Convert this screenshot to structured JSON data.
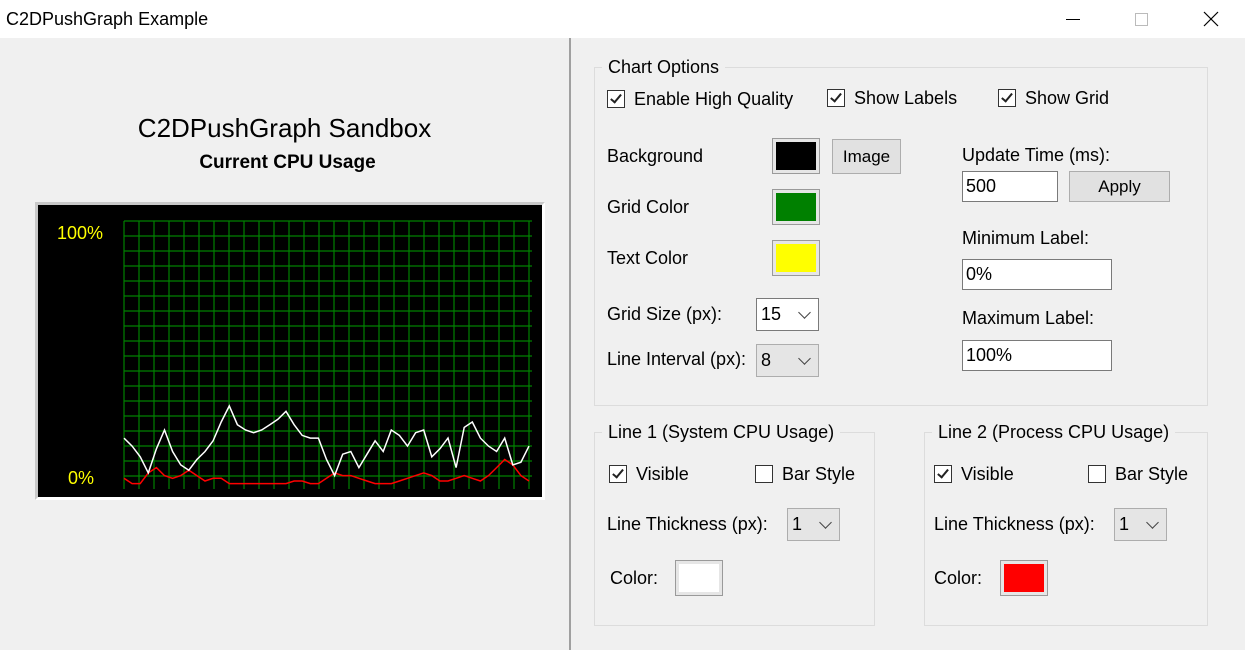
{
  "window": {
    "title": "C2DPushGraph Example"
  },
  "left": {
    "heading": "C2DPushGraph Sandbox",
    "subheading": "Current CPU Usage",
    "graph": {
      "max_label": "100%",
      "min_label": "0%",
      "background_color": "#000000",
      "grid_color": "#008000",
      "text_color": "#ffff00",
      "line1_color": "#ffffff",
      "line2_color": "#ff0000"
    }
  },
  "chart_data": {
    "type": "line",
    "title": "",
    "xlabel": "",
    "ylabel": "",
    "ylim": [
      0,
      100
    ],
    "grid": true,
    "x": [
      0,
      1,
      2,
      3,
      4,
      5,
      6,
      7,
      8,
      9,
      10,
      11,
      12,
      13,
      14,
      15,
      16,
      17,
      18,
      19,
      20,
      21,
      22,
      23,
      24,
      25,
      26,
      27,
      28,
      29,
      30,
      31,
      32,
      33,
      34,
      35,
      36,
      37,
      38,
      39,
      40,
      41,
      42,
      43,
      44,
      45,
      46,
      47,
      48,
      49,
      50
    ],
    "series": [
      {
        "values": [
          19,
          16,
          12,
          6,
          15,
          22,
          14,
          9,
          7,
          11,
          14,
          18,
          25,
          31,
          24,
          22,
          21,
          22,
          24,
          26,
          29,
          24,
          20,
          19,
          19,
          11,
          5,
          13,
          14,
          8,
          13,
          18,
          14,
          22,
          20,
          16,
          21,
          22,
          12,
          15,
          19,
          8,
          23,
          25,
          19,
          16,
          14,
          19,
          9,
          10,
          16
        ]
      },
      {
        "values": [
          4,
          2,
          2,
          6,
          8,
          5,
          4,
          5,
          7,
          5,
          3,
          4,
          4,
          2,
          2,
          2,
          2,
          2,
          2,
          2,
          2,
          3,
          3,
          2,
          2,
          4,
          6,
          5,
          5,
          4,
          3,
          2,
          2,
          2,
          3,
          4,
          5,
          6,
          5,
          3,
          3,
          4,
          5,
          4,
          3,
          5,
          8,
          11,
          9,
          5,
          3
        ]
      }
    ]
  },
  "options": {
    "legend": "Chart Options",
    "enable_hq": {
      "label": "Enable High Quality",
      "checked": true
    },
    "show_labels": {
      "label": "Show Labels",
      "checked": true
    },
    "show_grid": {
      "label": "Show Grid",
      "checked": true
    },
    "background_label": "Background",
    "background_color": "#000000",
    "image_button": "Image",
    "grid_color_label": "Grid Color",
    "grid_color": "#008000",
    "text_color_label": "Text Color",
    "text_color": "#ffff00",
    "grid_size_label": "Grid Size (px):",
    "grid_size_value": "15",
    "line_interval_label": "Line Interval (px):",
    "line_interval_value": "8",
    "update_time_label": "Update Time (ms):",
    "update_time_value": "500",
    "apply_button": "Apply",
    "min_label_label": "Minimum Label:",
    "min_label_value": "0%",
    "max_label_label": "Maximum Label:",
    "max_label_value": "100%"
  },
  "line1": {
    "legend": "Line 1  (System CPU Usage)",
    "visible": {
      "label": "Visible",
      "checked": true
    },
    "bar_style": {
      "label": "Bar Style",
      "checked": false
    },
    "thickness_label": "Line Thickness (px):",
    "thickness_value": "1",
    "color_label": "Color:",
    "color": "#ffffff"
  },
  "line2": {
    "legend": "Line 2  (Process CPU Usage)",
    "visible": {
      "label": "Visible",
      "checked": true
    },
    "bar_style": {
      "label": "Bar Style",
      "checked": false
    },
    "thickness_label": "Line Thickness (px):",
    "thickness_value": "1",
    "color_label": "Color:",
    "color": "#ff0000"
  }
}
